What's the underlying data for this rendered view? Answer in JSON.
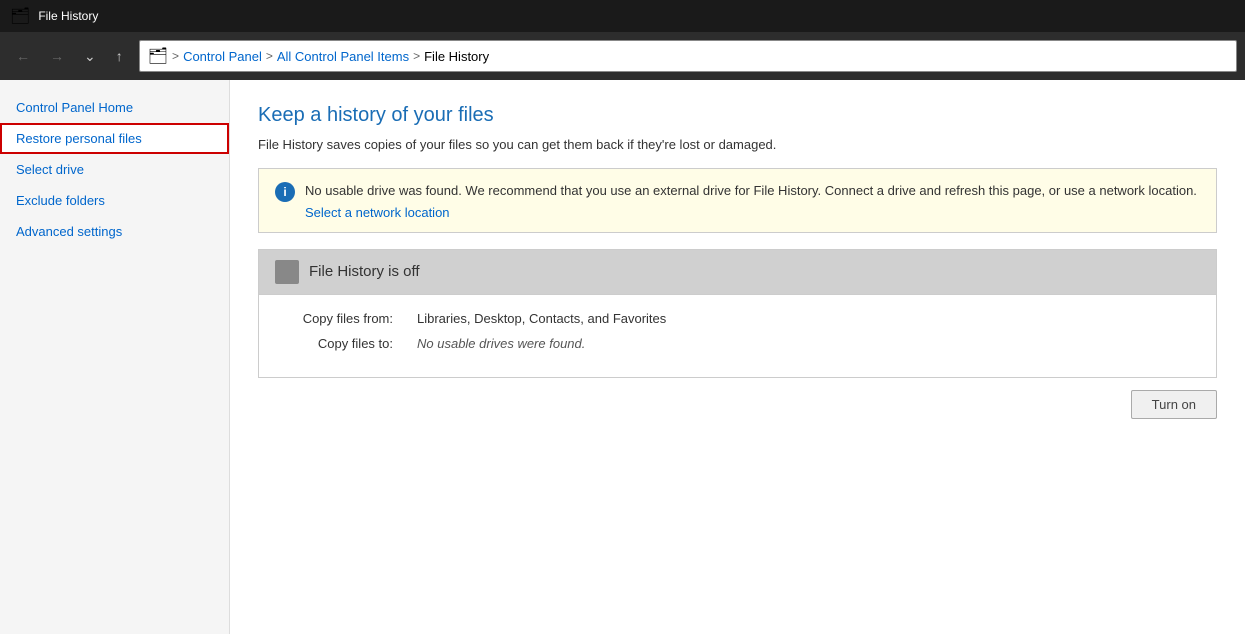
{
  "titleBar": {
    "icon": "🗂",
    "title": "File History"
  },
  "navBar": {
    "backBtn": "←",
    "forwardBtn": "→",
    "dropdownBtn": "⌄",
    "upBtn": "↑",
    "breadcrumb": {
      "icon": "🗂",
      "items": [
        "Control Panel",
        "All Control Panel Items",
        "File History"
      ],
      "separators": [
        ">",
        ">",
        ">"
      ]
    }
  },
  "sidebar": {
    "items": [
      {
        "id": "control-panel-home",
        "label": "Control Panel Home",
        "selected": false
      },
      {
        "id": "restore-personal-files",
        "label": "Restore personal files",
        "selected": true
      },
      {
        "id": "select-drive",
        "label": "Select drive",
        "selected": false
      },
      {
        "id": "exclude-folders",
        "label": "Exclude folders",
        "selected": false
      },
      {
        "id": "advanced-settings",
        "label": "Advanced settings",
        "selected": false
      }
    ]
  },
  "content": {
    "title": "Keep a history of your files",
    "description": "File History saves copies of your files so you can get them back if they're lost or damaged.",
    "warningBox": {
      "message": "No usable drive was found. We recommend that you use an external drive for File History. Connect a drive and refresh this page, or use a network location.",
      "linkText": "Select a network location"
    },
    "statusBox": {
      "title": "File History is off",
      "rows": [
        {
          "label": "Copy files from:",
          "value": "Libraries, Desktop, Contacts, and Favorites",
          "italic": false
        },
        {
          "label": "Copy files to:",
          "value": "No usable drives were found.",
          "italic": true
        }
      ]
    },
    "turnOnBtn": "Turn on"
  }
}
